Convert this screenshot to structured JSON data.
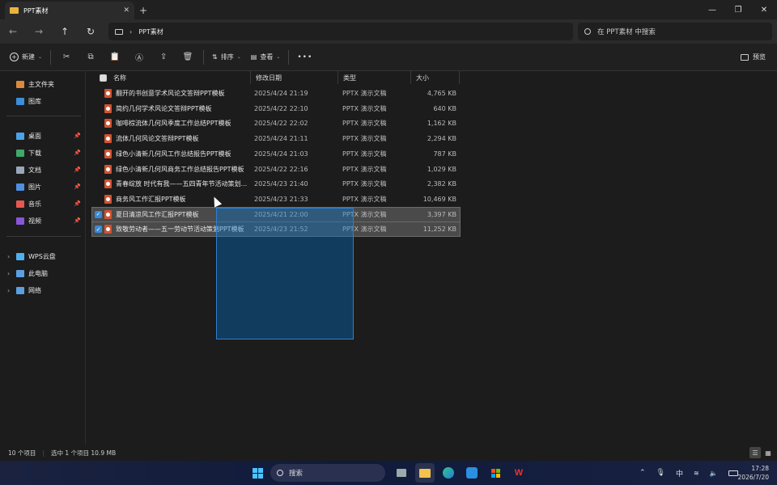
{
  "window": {
    "tab_title": "PPT素材",
    "tab_close": "✕",
    "new_tab": "+",
    "minimize": "—",
    "maximize": "❐",
    "close": "✕"
  },
  "address": {
    "path_segment": "PPT素材",
    "search_placeholder": "在 PPT素材 中搜索"
  },
  "toolbar": {
    "new_label": "新建",
    "sort_label": "排序",
    "view_label": "查看",
    "more_label": "•••",
    "preview_label": "预览"
  },
  "sidebar": {
    "top": [
      {
        "label": "主文件夹",
        "icon": "home-icon",
        "color": "#d98a3c"
      },
      {
        "label": "图库",
        "icon": "gallery-icon",
        "color": "#3b8ed8"
      }
    ],
    "pinned": [
      {
        "label": "桌面",
        "icon": "desktop-icon",
        "color": "#4aa3e6"
      },
      {
        "label": "下载",
        "icon": "download-icon",
        "color": "#3fa86a"
      },
      {
        "label": "文档",
        "icon": "documents-icon",
        "color": "#9aa7b8"
      },
      {
        "label": "图片",
        "icon": "pictures-icon",
        "color": "#4f8fe0"
      },
      {
        "label": "音乐",
        "icon": "music-icon",
        "color": "#e5584f"
      },
      {
        "label": "视频",
        "icon": "videos-icon",
        "color": "#8a56d8"
      }
    ],
    "bottom": [
      {
        "label": "WPS云盘",
        "icon": "wps-cloud-icon",
        "color": "#4fb0f0"
      },
      {
        "label": "此电脑",
        "icon": "this-pc-icon",
        "color": "#5aa0e0"
      },
      {
        "label": "网络",
        "icon": "network-icon",
        "color": "#5aa0e0"
      }
    ]
  },
  "columns": {
    "name": "名称",
    "date": "修改日期",
    "type": "类型",
    "size": "大小"
  },
  "files": [
    {
      "name": "翻开的书创意学术风论文答辩PPT模板",
      "date": "2025/4/24 21:19",
      "type": "PPTX 演示文稿",
      "size": "4,765 KB",
      "selected": false
    },
    {
      "name": "简约几何学术风论文答辩PPT模板",
      "date": "2025/4/22 22:10",
      "type": "PPTX 演示文稿",
      "size": "640 KB",
      "selected": false
    },
    {
      "name": "咖啡棕流体几何风季度工作总结PPT模板",
      "date": "2025/4/22 22:02",
      "type": "PPTX 演示文稿",
      "size": "1,162 KB",
      "selected": false
    },
    {
      "name": "流体几何风论文答辩PPT模板",
      "date": "2025/4/24 21:11",
      "type": "PPTX 演示文稿",
      "size": "2,294 KB",
      "selected": false
    },
    {
      "name": "绿色小清新几何风工作总结报告PPT模板",
      "date": "2025/4/24 21:03",
      "type": "PPTX 演示文稿",
      "size": "787 KB",
      "selected": false
    },
    {
      "name": "绿色小清新几何风商务工作总结报告PPT模板",
      "date": "2025/4/22 22:16",
      "type": "PPTX 演示文稿",
      "size": "1,029 KB",
      "selected": false
    },
    {
      "name": "青春绽放 时代有我——五四青年节活动策划...",
      "date": "2025/4/23 21:40",
      "type": "PPTX 演示文稿",
      "size": "2,382 KB",
      "selected": false
    },
    {
      "name": "商务风工作汇报PPT模板",
      "date": "2025/4/23 21:33",
      "type": "PPTX 演示文稿",
      "size": "10,469 KB",
      "selected": false
    },
    {
      "name": "夏日清凉风工作汇报PPT模板",
      "date": "2025/4/21 22:00",
      "type": "PPTX 演示文稿",
      "size": "3,397 KB",
      "selected": true
    },
    {
      "name": "致敬劳动者——五一劳动节活动策划PPT模板",
      "date": "2025/4/23 21:52",
      "type": "PPTX 演示文稿",
      "size": "11,252 KB",
      "selected": true
    }
  ],
  "status": {
    "count": "10 个项目",
    "selection": "选中 1 个项目  10.9 MB"
  },
  "taskbar": {
    "search_label": "搜索",
    "ime": "中",
    "time": "17:28",
    "date": "2026/7/20"
  }
}
